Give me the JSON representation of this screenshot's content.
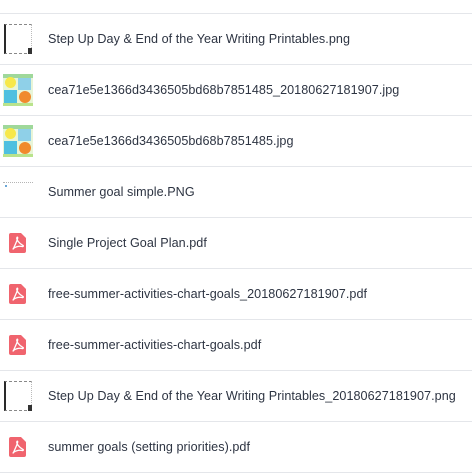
{
  "files": [
    {
      "name": "Step Up Day & End of the Year Writing Printables.png",
      "icon": "document-thumbnail-icon"
    },
    {
      "name": "cea71e5e1366d3436505bd68b7851485_20180627181907.jpg",
      "icon": "image-thumbnail-icon"
    },
    {
      "name": "cea71e5e1366d3436505bd68b7851485.jpg",
      "icon": "image-thumbnail-icon"
    },
    {
      "name": "Summer goal simple.PNG",
      "icon": "note-thumbnail-icon"
    },
    {
      "name": "Single Project Goal Plan.pdf",
      "icon": "pdf-icon"
    },
    {
      "name": "free-summer-activities-chart-goals_20180627181907.pdf",
      "icon": "pdf-icon"
    },
    {
      "name": "free-summer-activities-chart-goals.pdf",
      "icon": "pdf-icon"
    },
    {
      "name": "Step Up Day & End of the Year Writing Printables_20180627181907.png",
      "icon": "document-thumbnail-icon"
    },
    {
      "name": "summer goals (setting priorities).pdf",
      "icon": "pdf-icon"
    }
  ],
  "colors": {
    "pdf_icon": "#f0646e",
    "divider": "#e4e6ea",
    "text": "#2d3442"
  }
}
